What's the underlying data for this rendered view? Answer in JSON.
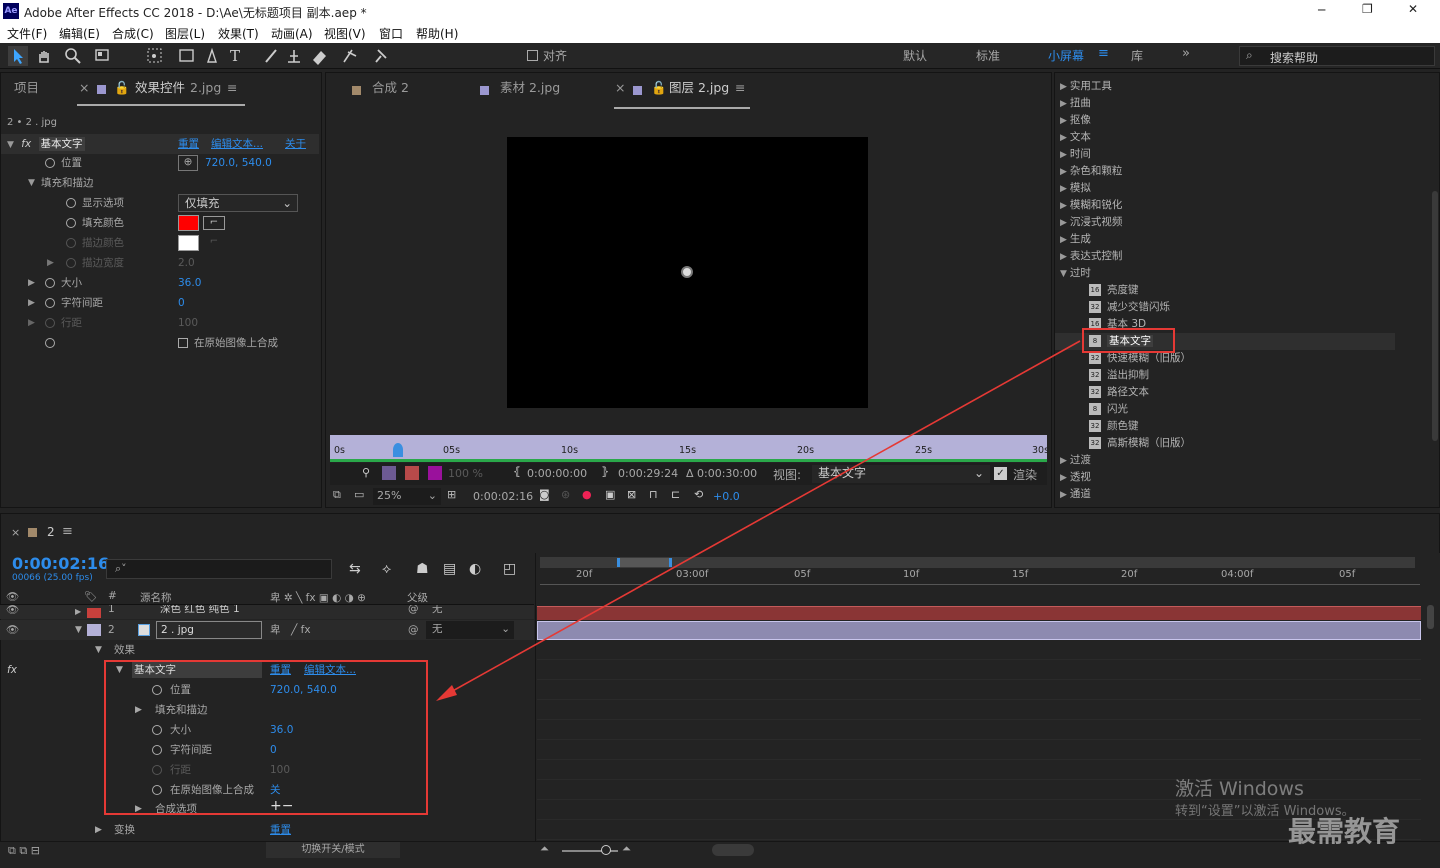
{
  "window": {
    "app_icon": "Ae",
    "title": "Adobe After Effects CC 2018 - D:\\Ae\\无标题项目 副本.aep *",
    "min": "─",
    "max": "❐",
    "close": "✕"
  },
  "menu": [
    "文件(F)",
    "编辑(E)",
    "合成(C)",
    "图层(L)",
    "效果(T)",
    "动画(A)",
    "视图(V)",
    "窗口",
    "帮助(H)"
  ],
  "toolbar": {
    "align": "对齐",
    "workspaces": [
      "默认",
      "标准",
      "小屏幕",
      "库"
    ],
    "active_workspace": "小屏幕",
    "search_placeholder": "搜索帮助"
  },
  "project_panel": {
    "tab_project": "项目",
    "tab_effects": "效果控件",
    "tab_effects_file": "2.jpg",
    "breadcrumb": "2 • 2 . jpg"
  },
  "effect_controls": {
    "effect_name": "基本文字",
    "reset": "重置",
    "edit_text": "编辑文本...",
    "about": "关于",
    "position_label": "位置",
    "position_value": "720.0, 540.0",
    "fill_stroke": "填充和描边",
    "display_option_label": "显示选项",
    "display_option_value": "仅填充",
    "fill_color_label": "填充颜色",
    "stroke_color_label": "描边颜色",
    "stroke_width_label": "描边宽度",
    "stroke_width_value": "2.0",
    "size_label": "大小",
    "size_value": "36.0",
    "tracking_label": "字符间距",
    "tracking_value": "0",
    "leading_label": "行距",
    "leading_value": "100",
    "composite_label": "在原始图像上合成",
    "fill_color": "#ff0000",
    "stroke_color": "#ffffff"
  },
  "viewer": {
    "tabs": [
      "合成 2",
      "素材 2.jpg",
      "图层 2.jpg"
    ],
    "ruler": [
      "0s",
      "05s",
      "10s",
      "15s",
      "20s",
      "25s",
      "30s"
    ],
    "time_in": "0:00:00:00",
    "time_out": "0:00:29:24",
    "duration": "Δ 0:00:30:00",
    "view_label": "视图:",
    "view_value": "基本文字",
    "render": "渲染",
    "zoom": "25%",
    "current_time": "0:00:02:16",
    "exposure": "+0.0",
    "opacity": "100 %"
  },
  "effects_list": {
    "groups_before": [
      "实用工具",
      "扭曲",
      "抠像",
      "文本",
      "时间",
      "杂色和颗粒",
      "模拟",
      "模糊和锐化",
      "沉浸式视频",
      "生成",
      "表达式控制"
    ],
    "obsolete": "过时",
    "obsolete_items": [
      "亮度键",
      "减少交错闪烁",
      "基本 3D",
      "基本文字",
      "快速模糊（旧版）",
      "溢出抑制",
      "路径文本",
      "闪光",
      "颜色键",
      "高斯模糊（旧版）"
    ],
    "groups_after": [
      "过渡",
      "透视",
      "通道"
    ]
  },
  "timeline": {
    "comp_tab": "2",
    "timecode": "0:00:02:16",
    "fps": "00066 (25.00 fps)",
    "col_name": "源名称",
    "col_parent": "父级",
    "layers": [
      {
        "num": "1",
        "name": "深色 红色 纯色 1",
        "parent": "无",
        "color": "#c8403c"
      },
      {
        "num": "2",
        "name": "2 . jpg",
        "parent": "无",
        "color": "#b4b1d8"
      }
    ],
    "effects_label": "效果",
    "effect_name": "基本文字",
    "reset": "重置",
    "edit_text": "编辑文本...",
    "position_label": "位置",
    "position_value": "720.0, 540.0",
    "fill_stroke": "填充和描边",
    "size_label": "大小",
    "size_value": "36.0",
    "tracking_label": "字符间距",
    "tracking_value": "0",
    "leading_label": "行距",
    "leading_value": "100",
    "composite_label": "在原始图像上合成",
    "composite_value": "关",
    "compositing_options": "合成选项",
    "transform": "变换",
    "transform_reset": "重置",
    "toggle_modes": "切换开关/模式",
    "ruler": [
      "20f",
      "03:00f",
      "05f",
      "10f",
      "15f",
      "20f",
      "04:00f",
      "05f"
    ]
  },
  "watermark": {
    "line1": "激活 Windows",
    "line2": "转到“设置”以激活 Windows。",
    "brand": "最需教育"
  },
  "colors": {
    "accent": "#2d8ceb",
    "highlight_box": "#e53935",
    "panel": "#232323"
  }
}
